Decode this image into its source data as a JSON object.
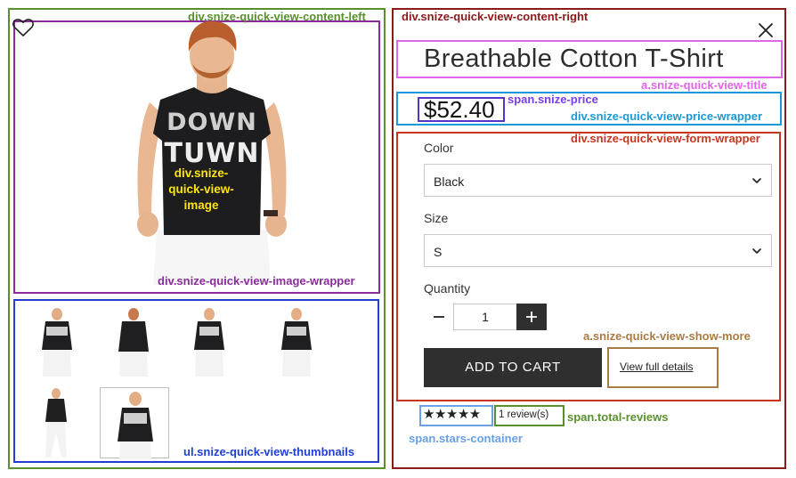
{
  "annotations": {
    "content_left": "div.snize-quick-view-content-left",
    "content_right": "div.snize-quick-view-content-right",
    "image": "div.snize-quick-view-image",
    "image_wrapper": "div.snize-quick-view-image-wrapper",
    "thumbnails": "ul.snize-quick-view-thumbnails",
    "title": "a.snize-quick-view-title",
    "price": "span.snize-price",
    "price_wrapper": "div.snize-quick-view-price-wrapper",
    "form_wrapper": "div.snize-quick-view-form-wrapper",
    "show_more": "a.snize-quick-view-show-more",
    "total_reviews": "span.total-reviews",
    "stars_container": "span.stars-container"
  },
  "annotation_colors": {
    "content_left": "#5a8f2e",
    "content_right": "#8b1a1a",
    "image": "#ffe600",
    "image_wrapper": "#8a2c9c",
    "thumbnails": "#1f3fd0",
    "title": "#e066e8",
    "price": "#5533cc",
    "price_wrapper": "#1a9ad6",
    "form_wrapper": "#c8371d",
    "show_more": "#a87c44",
    "total_reviews": "#5a8f2e",
    "stars_container": "#6aa0e6"
  },
  "product": {
    "title": "Breathable Cotton T-Shirt",
    "price": "$52.40",
    "shirt_print_top": "DOWN",
    "shirt_print_bottom": "TUWN"
  },
  "form": {
    "color_label": "Color",
    "color_value": "Black",
    "size_label": "Size",
    "size_value": "S",
    "quantity_label": "Quantity",
    "quantity_value": "1",
    "add_to_cart": "ADD TO CART",
    "view_details": "View full details"
  },
  "reviews": {
    "stars": "★★★★★",
    "rating": 5,
    "total": "1 review(s)"
  },
  "icons": {
    "wishlist": "heart-outline-icon",
    "close": "close-icon",
    "select_arrow": "chevron-down-icon",
    "minus": "minus-icon",
    "plus": "plus-icon"
  },
  "thumbnails": {
    "count": 6,
    "selected_index": 5
  }
}
